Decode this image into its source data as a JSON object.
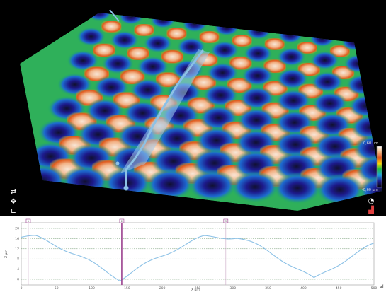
{
  "viewer": {
    "colors": {
      "background": "#000000",
      "low": "#1d1a8c",
      "mid": "#1db35a",
      "high": "#e05a1c",
      "peak": "#f4c9a8",
      "profile_line": "#8cc1e6"
    },
    "icons": [
      "rotate-icon",
      "move-icon",
      "axis-icon",
      "light-icon",
      "bar-chart-icon"
    ]
  },
  "color_scale": {
    "max_label": "0,60 µm",
    "min_label": "-0,60 µm",
    "colors": [
      "#ffffff",
      "#f5c08a",
      "#e3521a",
      "#ffd800",
      "#1fbf3a",
      "#1aa0e0",
      "#1d1a8c",
      "#000000"
    ]
  },
  "profile": {
    "y_ticks": [
      "20",
      "16",
      "12",
      "8",
      "4",
      "0"
    ],
    "x_ticks": [
      "0",
      "50",
      "100",
      "150",
      "200",
      "250",
      "300",
      "350",
      "400",
      "450",
      "500"
    ],
    "x_label": "X µm",
    "y_label": "Z µm",
    "marker_labels": [
      "1",
      "2",
      "3"
    ],
    "line_color": "#8cc1e6",
    "marker_color": "#9a3f8e"
  },
  "corner_icon": "resize-corner-icon"
}
